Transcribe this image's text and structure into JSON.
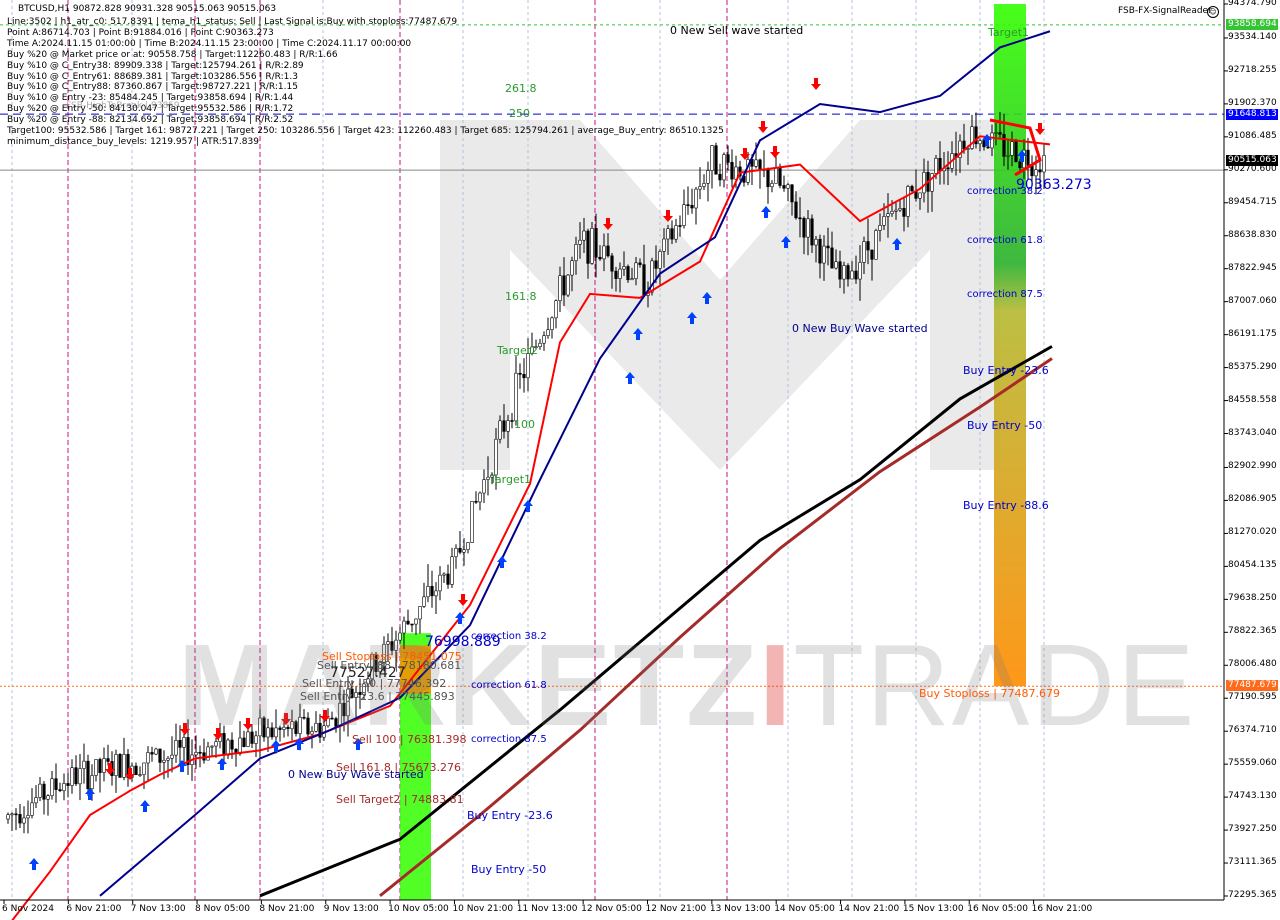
{
  "header": {
    "symbol_line": "BTCUSD,H1  90872.828 90931.328 90515.063 90515.063",
    "brand": "FSB-FX-SignalReader",
    "info_lines": [
      "Line:3502 | h1_atr_c0: 517.8391 | tema_h1_status: Sell | Last Signal is:Buy with stoploss:77487.679",
      "Point A:86714.703 | Point B:91884.016 | Point C:90363.273",
      "Time A:2024.11.15 01:00:00 | Time B:2024.11.15 23:00:00 | Time C:2024.11.17 00:00:00",
      "Buy %20 @ Market price or at: 90558.758 | Target:112260.483 | R/R:1.66",
      "Buy %10 @ C_Entry38: 89909.338 | Target:125794.261 | R/R:2.89",
      "Buy %10 @ C_Entry61: 88689.381 | Target:103286.556 | R/R:1.3",
      "Buy %10 @ C_Entry88: 87360.867 | Target:98727.221 | R/R:1.15",
      "Buy %10 @ Entry -23: 85484.245 | Target:93858.694 | R/R:1.44",
      "Buy %20 @ Entry -50: 84130.047 | Target:95532.586 | R/R:1.72",
      "Buy %20 @ Entry -88: 82134.692 | Target:93858.694 | R/R:2.52",
      "Target100: 95532.586 | Target 161: 98727.221 | Target 250: 103286.556 | Target 423: 112260.483 | Target 685: 125794.261 | average_Buy_entry: 86510.1325",
      "minimum_distance_buy_levels: 1219.957 | ATR:517.839"
    ]
  },
  "price_axis": {
    "ticks": [
      "94374.790",
      "93534.140",
      "92718.255",
      "91902.370",
      "91086.485",
      "90270.600",
      "89454.715",
      "88638.830",
      "87822.945",
      "87007.060",
      "86191.175",
      "85375.290",
      "84558.558",
      "83743.040",
      "82902.990",
      "82086.905",
      "81270.020",
      "80454.135",
      "79638.250",
      "78822.365",
      "78006.480",
      "77190.595",
      "76374.710",
      "75559.060",
      "74743.130",
      "73927.250",
      "73111.365",
      "72295.365"
    ],
    "top_box": "93858.694",
    "top_box_color": "#34c534",
    "mid_box": "91648.813",
    "mid_box_color": "#0000ff",
    "current_box": "90515.063",
    "current_box_color": "#000000",
    "stop_box": "77487.679",
    "stop_box_color": "#ff6a1a"
  },
  "time_axis": {
    "labels": [
      "6 Nov 2024",
      "6 Nov 21:00",
      "7 Nov 13:00",
      "8 Nov 05:00",
      "8 Nov 21:00",
      "9 Nov 13:00",
      "10 Nov 05:00",
      "10 Nov 21:00",
      "11 Nov 13:00",
      "12 Nov 05:00",
      "12 Nov 21:00",
      "13 Nov 13:00",
      "14 Nov 05:00",
      "14 Nov 21:00",
      "15 Nov 13:00",
      "16 Nov 05:00",
      "16 Nov 21:00"
    ]
  },
  "annotations": {
    "new_sell_wave": "0 New Sell wave started",
    "target1_right": "Target1",
    "fib_2618": "261.8",
    "fib_250": "250",
    "fib_1618": "161.8",
    "target2": "Target2",
    "fib_100": "100",
    "target1_left": "Target1",
    "fsb_overlay": "FSB-HighToBreak | 93859",
    "new_buy_wave_right": "0 New Buy Wave started",
    "correction_382_right": "correction 38.2",
    "correction_618_right": "correction 61.8",
    "correction_875_right": "correction 87.5",
    "point_c_value": "90363.273",
    "buy_entry_236_right": "Buy Entry -23.6",
    "buy_entry_50_right": "Buy Entry -50",
    "buy_entry_886_right": "Buy Entry -88.6",
    "buy_stoploss": "Buy Stoploss | 77487.679",
    "point_a_value": "76998.889",
    "correction_382_left": "correction 38.2",
    "correction_618_left": "correction 61.8",
    "correction_875_left": "correction 87.5",
    "sell_stoploss": "Sell Stoploss | 78451.075",
    "sell_entry_88": "Sell Entry -88 | 78180.681",
    "sell_entry_50": "Sell Entry -50 | 77746.392",
    "sell_entry_23": "Sell Entry -23.6 | 77445.893",
    "point_b_value": "77527.427",
    "sell_100": "Sell 100 | 76381.398",
    "sell_1618": "Sell 161.8 | 75673.276",
    "new_buy_wave_left": "0 New Buy Wave started",
    "sell_target2": "Sell Target2 | 74883.81",
    "buy_entry_236_left": "Buy Entry -23.6",
    "buy_entry_50_left": "Buy Entry -50"
  },
  "watermark": {
    "text_left": "MARKETZ",
    "text_accent": "I",
    "text_right": "TRADE"
  },
  "colors": {
    "ema_fast": "#ff0000",
    "ema_mid": "#00008b",
    "sma_slow": "#000000",
    "sma_slowest": "#a52a2a",
    "green_zone": "#33ff00",
    "orange_zone": "#ff8c00",
    "up_arrow": "#0040ff",
    "down_arrow": "#ff0000"
  },
  "chart_data": {
    "type": "candlestick",
    "symbol": "BTCUSD",
    "timeframe": "H1",
    "ohlc_last": {
      "open": 90872.828,
      "high": 90931.328,
      "low": 90515.063,
      "close": 90515.063
    },
    "ylim": [
      72295.365,
      94374.79
    ],
    "x_range": [
      "6 Nov 2024",
      "16 Nov 21:00"
    ],
    "close_path": [
      [
        "6 Nov 2024",
        74200
      ],
      [
        "6 Nov 21:00",
        75200
      ],
      [
        "7 Nov 13:00",
        75600
      ],
      [
        "8 Nov 05:00",
        75900
      ],
      [
        "8 Nov 21:00",
        76300
      ],
      [
        "9 Nov 13:00",
        76500
      ],
      [
        "10 Nov 05:00",
        78500
      ],
      [
        "10 Nov 21:00",
        80500
      ],
      [
        "11 Nov 13:00",
        85000
      ],
      [
        "12 Nov 05:00",
        88500
      ],
      [
        "12 Nov 21:00",
        87500
      ],
      [
        "13 Nov 13:00",
        90500
      ],
      [
        "14 Nov 05:00",
        90000
      ],
      [
        "14 Nov 21:00",
        87500
      ],
      [
        "15 Nov 13:00",
        89500
      ],
      [
        "16 Nov 05:00",
        91200
      ],
      [
        "16 Nov 21:00",
        90515
      ]
    ],
    "levels": {
      "target_high": 93858.694,
      "point_b": 91884.016,
      "line_250": 91648.813,
      "point_c": 90363.273,
      "point_a": 86714.703,
      "buy_stoploss": 77487.679
    }
  }
}
